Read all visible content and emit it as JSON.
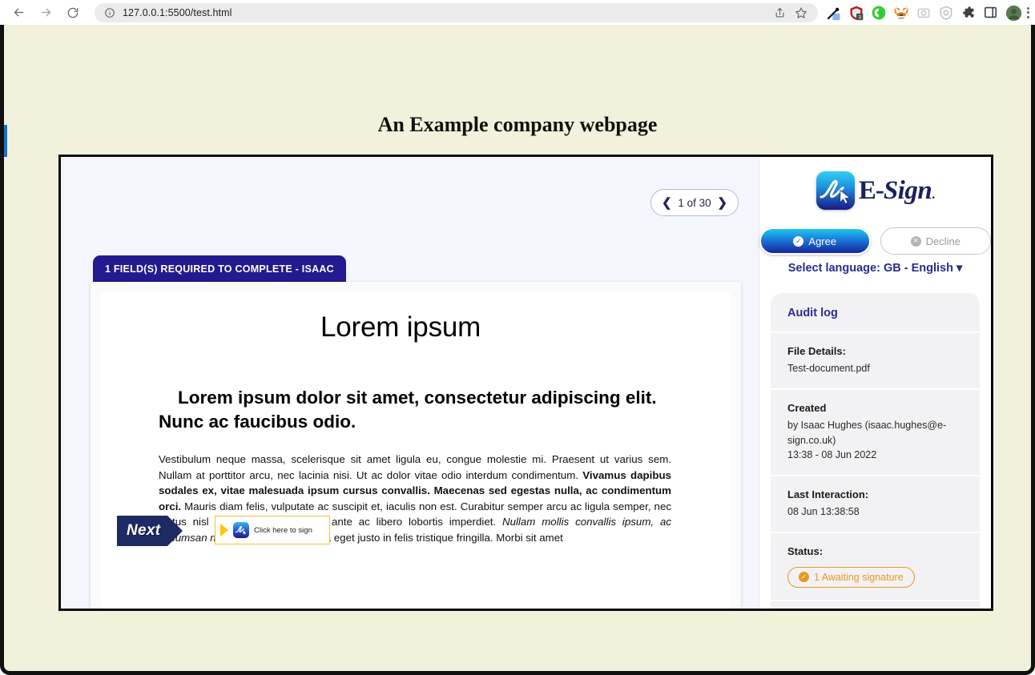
{
  "browser": {
    "back_icon": "arrow-left-icon",
    "forward_icon": "arrow-right-icon",
    "reload_icon": "reload-icon",
    "site_info_icon": "info-circle-icon",
    "url": "127.0.0.1:5500/test.html",
    "share_icon": "share-icon",
    "bookmark_icon": "star-icon",
    "menu_icon": "kebab-menu-icon",
    "extensions": [
      "eyedropper-extension-icon",
      "ublock-extension-icon",
      "privacy-badger-extension-icon",
      "metamask-extension-icon",
      "screenshot-extension-icon",
      "shield-extension-icon",
      "puzzle-extensions-icon",
      "sidepanel-icon",
      "profile-avatar-icon"
    ],
    "extension_badge": "3"
  },
  "page": {
    "title": "An Example company webpage",
    "background_color": "#f2f1db"
  },
  "esign": {
    "pager": {
      "prev_icon": "chevron-left-icon",
      "next_icon": "chevron-right-icon",
      "label": "1 of 30",
      "current_page": 1,
      "total_pages": 30
    },
    "required_banner": "1 FIELD(S) REQUIRED TO COMPLETE - ISAAC",
    "next_flag": "Next",
    "signature_field": {
      "label": "Click here to sign",
      "arrow_icon": "play-triangle-icon",
      "logo_icon": "esign-mark-icon",
      "border_color": "#f0c237"
    },
    "document": {
      "heading": "Lorem ipsum",
      "subheading": "Lorem ipsum dolor sit amet, consectetur adipiscing elit. Nunc ac faucibus odio.",
      "body": {
        "p1": "Vestibulum neque massa, scelerisque sit amet ligula eu, congue molestie mi. Praesent ut varius sem. Nullam at porttitor arcu, nec lacinia nisi. Ut ac dolor vitae odio interdum condimentum. ",
        "bold1": "Vivamus dapibus sodales ex, vitae malesuada ipsum cursus convallis. Maecenas sed egestas nulla, ac condimentum orci.",
        "p2": " Mauris diam felis, vulputate ac suscipit et, iaculis non est. Curabitur semper arcu ac ligula semper, nec luctus nisl blandit. Integer lacinia ante ac libero lobortis imperdiet. ",
        "italic1": "Nullam mollis convallis ipsum, ac accumsan nunc vehicula vitae.",
        "p3": " Nulla eget justo in felis tristique fringilla. Morbi sit amet"
      }
    },
    "brand": {
      "logo_icon": "esign-mark-icon",
      "word_e": "E-",
      "word_sign": "Sign",
      "word_dot": "."
    },
    "agree_button": {
      "label": "Agree",
      "icon": "check-circle-icon",
      "color": "#1a6fd6"
    },
    "decline_button": {
      "label": "Decline",
      "icon": "x-circle-icon",
      "color": "#9b9b9b"
    },
    "language_selector": {
      "label": "Select language: GB - English",
      "caret": "▾",
      "color": "#2d2a8c"
    },
    "audit": {
      "title": "Audit log",
      "file_details_label": "File Details:",
      "file_details_value": "Test-document.pdf",
      "created_label": "Created",
      "created_by": "by Isaac Hughes (isaac.hughes@e-sign.co.uk)",
      "created_at": "13:38 - 08 Jun 2022",
      "last_interaction_label": "Last Interaction:",
      "last_interaction_value": "08 Jun 13:38:58",
      "status_label": "Status:",
      "status_badge": "1 Awaiting signature",
      "status_color": "#eb9720"
    }
  }
}
